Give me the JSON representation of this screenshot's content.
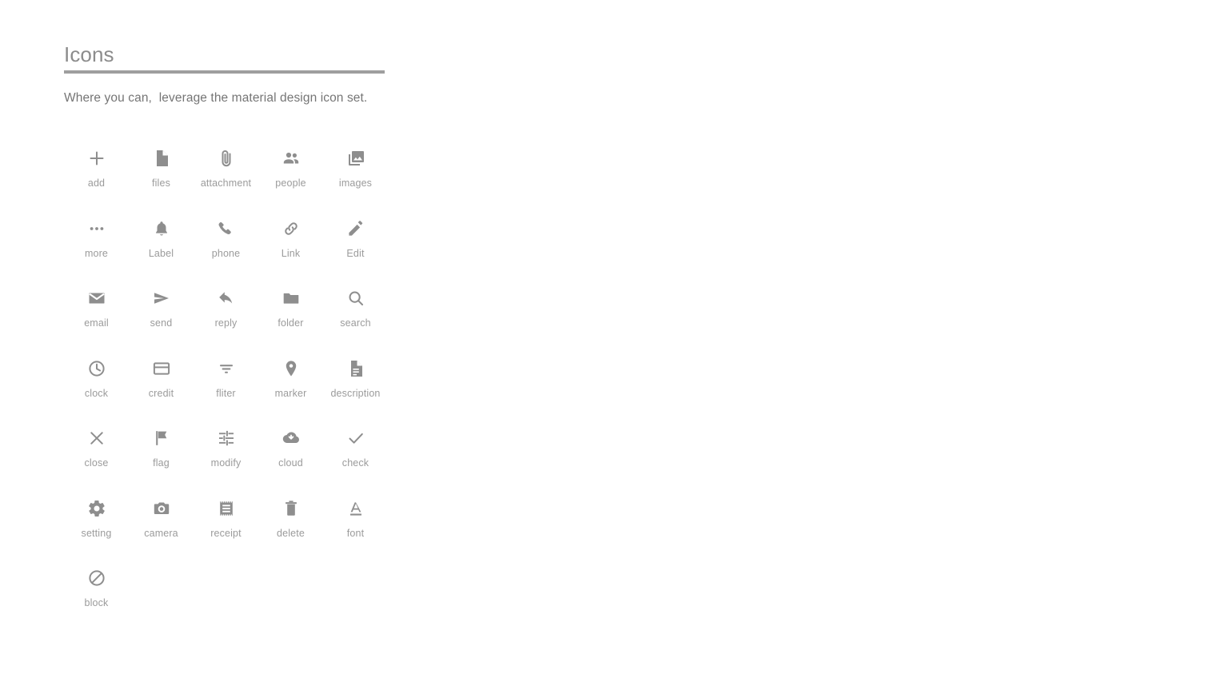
{
  "page": {
    "title": "Icons",
    "subtitle": "Where you can,  leverage the material design icon set.",
    "accent_color": "#9e9e9e",
    "icon_color": "#8e8e8e",
    "label_color": "#9b9b9b",
    "background_color": "#ffffff",
    "columns": 5
  },
  "icons": [
    {
      "label": "add",
      "icon": "plus-icon"
    },
    {
      "label": "files",
      "icon": "document-icon"
    },
    {
      "label": "attachment",
      "icon": "paperclip-icon"
    },
    {
      "label": "people",
      "icon": "people-icon"
    },
    {
      "label": "images",
      "icon": "photo-library-icon"
    },
    {
      "label": "more",
      "icon": "more-horizontal-icon"
    },
    {
      "label": "Label",
      "icon": "bell-icon"
    },
    {
      "label": "phone",
      "icon": "phone-icon"
    },
    {
      "label": "Link",
      "icon": "link-icon"
    },
    {
      "label": "Edit",
      "icon": "pencil-icon"
    },
    {
      "label": "email",
      "icon": "envelope-icon"
    },
    {
      "label": "send",
      "icon": "send-icon"
    },
    {
      "label": "reply",
      "icon": "reply-arrow-icon"
    },
    {
      "label": "folder",
      "icon": "folder-icon"
    },
    {
      "label": "search",
      "icon": "magnifier-icon"
    },
    {
      "label": "clock",
      "icon": "clock-icon"
    },
    {
      "label": "credit",
      "icon": "credit-card-icon"
    },
    {
      "label": "fliter",
      "icon": "filter-list-icon"
    },
    {
      "label": "marker",
      "icon": "map-pin-icon"
    },
    {
      "label": "description",
      "icon": "description-icon"
    },
    {
      "label": "close",
      "icon": "close-x-icon"
    },
    {
      "label": "flag",
      "icon": "flag-icon"
    },
    {
      "label": "modify",
      "icon": "tune-sliders-icon"
    },
    {
      "label": "cloud",
      "icon": "cloud-download-icon"
    },
    {
      "label": "check",
      "icon": "checkmark-icon"
    },
    {
      "label": "setting",
      "icon": "gear-icon"
    },
    {
      "label": "camera",
      "icon": "camera-icon"
    },
    {
      "label": "receipt",
      "icon": "receipt-icon"
    },
    {
      "label": "delete",
      "icon": "trash-icon"
    },
    {
      "label": "font",
      "icon": "font-format-icon"
    },
    {
      "label": "block",
      "icon": "block-icon"
    }
  ]
}
